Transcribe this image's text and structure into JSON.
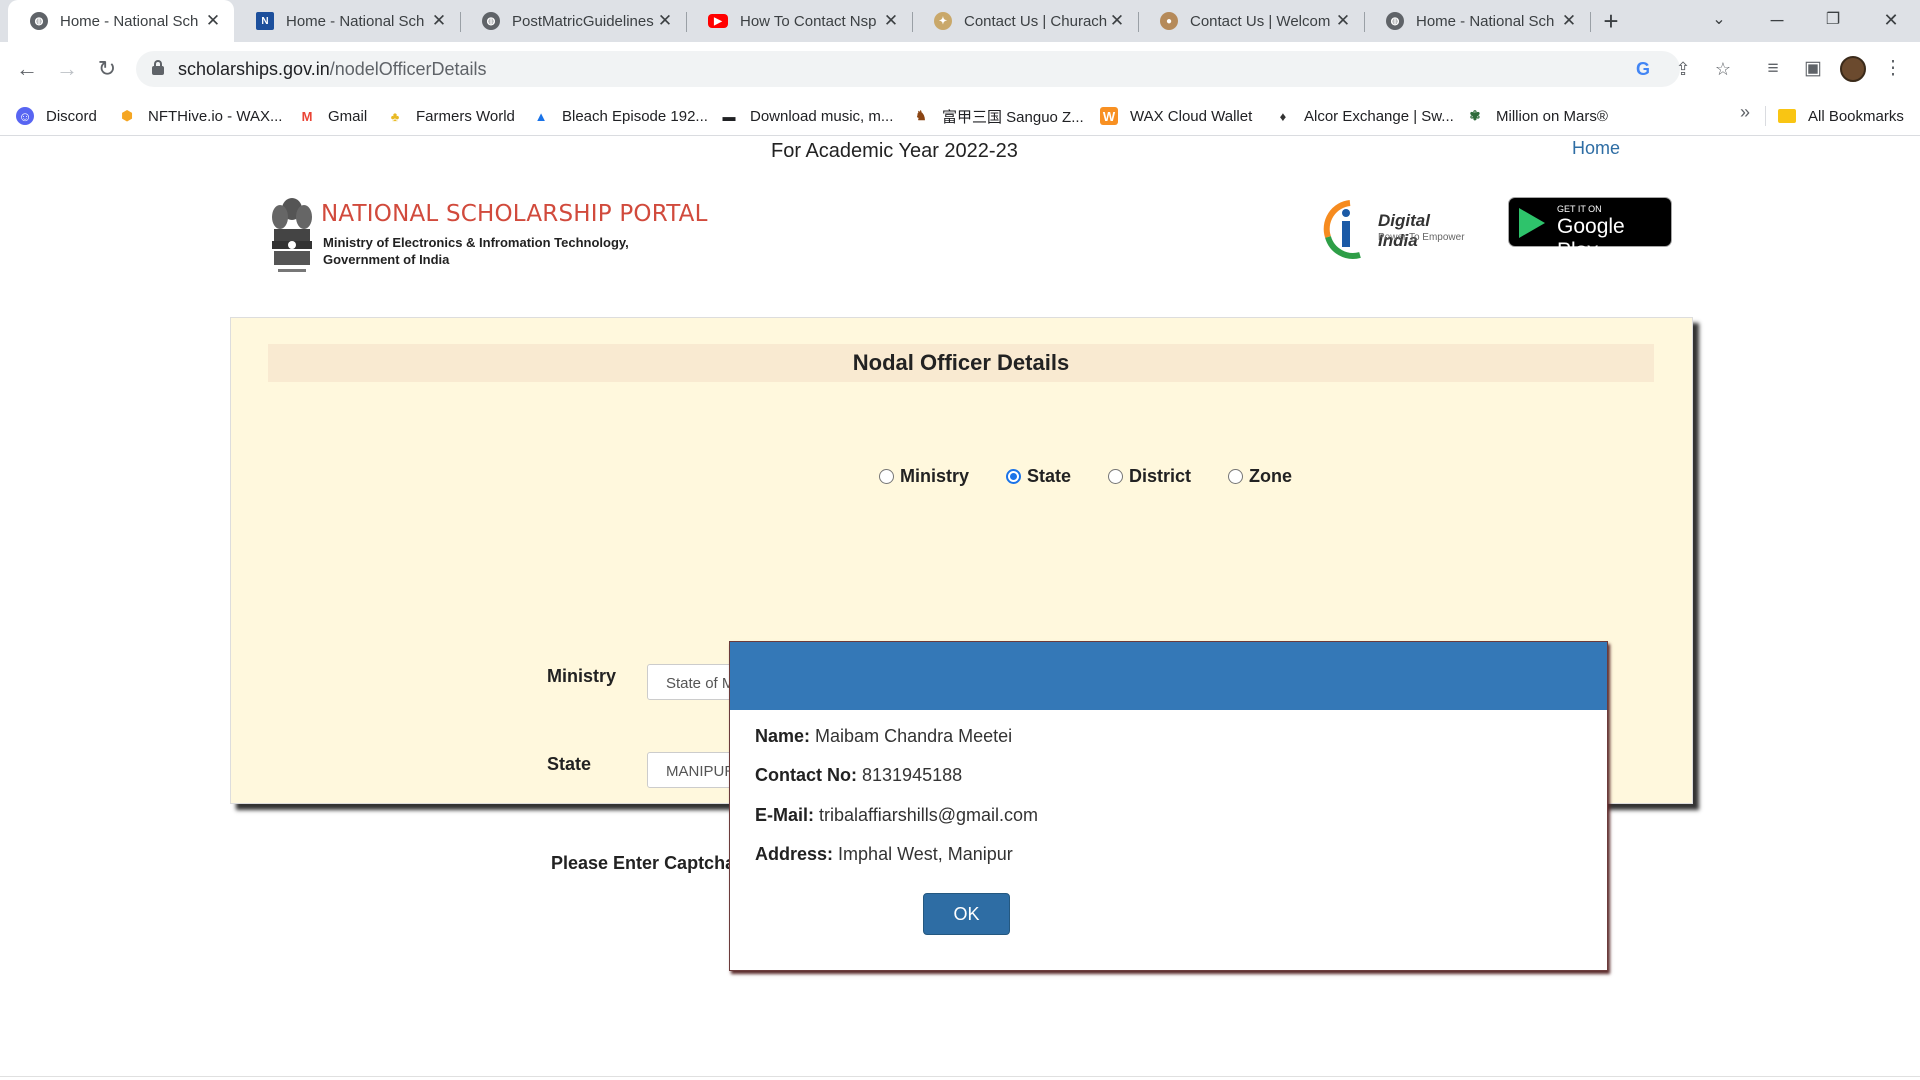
{
  "tabs": [
    {
      "title": "Home - National Sch",
      "icon": "globe-icon",
      "active": true
    },
    {
      "title": "Home - National Sch",
      "icon": "nic-icon",
      "active": false
    },
    {
      "title": "PostMatricGuidelines",
      "icon": "globe-icon",
      "active": false
    },
    {
      "title": "How To Contact Nsp",
      "icon": "youtube-icon",
      "active": false
    },
    {
      "title": "Contact Us | Churach",
      "icon": "emblem-icon",
      "active": false
    },
    {
      "title": "Contact Us | Welcom",
      "icon": "seal-icon",
      "active": false
    },
    {
      "title": "Home - National Sch",
      "icon": "globe-icon",
      "active": false
    }
  ],
  "address_bar": {
    "domain": "scholarships.gov.in",
    "path": "/nodelOfficerDetails"
  },
  "bookmarks": [
    {
      "label": "Discord",
      "icon": "discord-icon",
      "color": "#5865f2"
    },
    {
      "label": "NFTHive.io - WAX...",
      "icon": "nfthive-icon",
      "color": "#f5a623"
    },
    {
      "label": "Gmail",
      "icon": "gmail-icon",
      "color": "#ea4335"
    },
    {
      "label": "Farmers World",
      "icon": "farmers-world-icon",
      "color": "#e8b923"
    },
    {
      "label": "Bleach Episode 192...",
      "icon": "bleach-icon",
      "color": "#1a73e8"
    },
    {
      "label": "Download music, m...",
      "icon": "download-icon",
      "color": "#202124"
    },
    {
      "label": "富甲三国 Sanguo Z...",
      "icon": "sanguo-icon",
      "color": "#8b4513"
    },
    {
      "label": "WAX Cloud Wallet",
      "icon": "wax-icon",
      "color": "#f89022"
    },
    {
      "label": "Alcor Exchange | Sw...",
      "icon": "alcor-icon",
      "color": "#333333"
    },
    {
      "label": "Million on Mars®",
      "icon": "mars-icon",
      "color": "#2f6b3a"
    }
  ],
  "all_bookmarks": "All Bookmarks",
  "page": {
    "academic_year": "For Academic Year 2022-23",
    "home_link": "Home",
    "portal_title": "NATIONAL SCHOLARSHIP PORTAL",
    "portal_sub1": "Ministry of Electronics & Infromation Technology,",
    "portal_sub2": "Government of India",
    "digital_india": "Digital India",
    "digital_india_tag": "Power To Empower",
    "gplay_get": "GET IT ON",
    "gplay_name": "Google Play"
  },
  "panel": {
    "heading": "Nodal Officer Details",
    "radio_options": [
      {
        "label": "Ministry",
        "checked": false
      },
      {
        "label": "State",
        "checked": true
      },
      {
        "label": "District",
        "checked": false
      },
      {
        "label": "Zone",
        "checked": false
      }
    ],
    "ministry_label": "Ministry",
    "ministry_value": "State of M",
    "state_label": "State",
    "state_value": "MANIPUR",
    "captcha_label": "Please Enter Captcha"
  },
  "modal": {
    "name_label": "Name:",
    "name_value": "Maibam Chandra Meetei",
    "contact_label": "Contact No:",
    "contact_value": "8131945188",
    "email_label": "E-Mail:",
    "email_value": "tribalaffiarshills@gmail.com",
    "address_label": "Address:",
    "address_value": "Imphal West, Manipur",
    "ok_label": "OK"
  },
  "colors": {
    "modal_header": "#3478b7",
    "panel_bg": "#fff8dd",
    "ok_button": "#2e6da4",
    "portal_title": "#d14a3c"
  }
}
